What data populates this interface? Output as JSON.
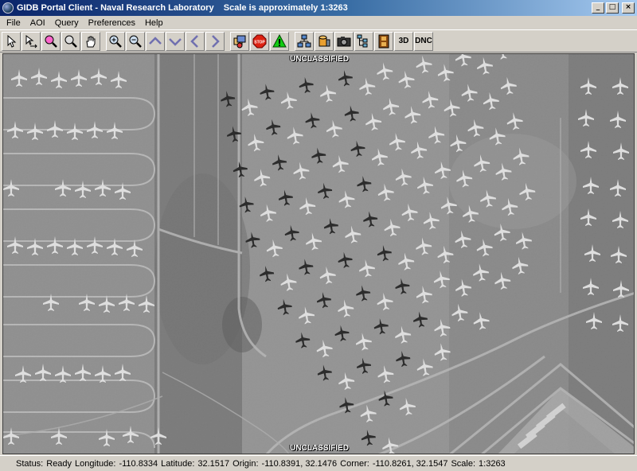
{
  "window": {
    "title": "GIDB Portal Client - Naval Research Laboratory    Scale is approximately 1:3263",
    "controls": [
      "minimize",
      "maximize",
      "close"
    ]
  },
  "menu": [
    "File",
    "AOI",
    "Query",
    "Preferences",
    "Help"
  ],
  "toolbar": {
    "buttons": [
      {
        "icon": "pointer-icon"
      },
      {
        "icon": "select-aoi-icon"
      },
      {
        "icon": "zoom-region-icon"
      },
      {
        "icon": "magnify-icon"
      },
      {
        "icon": "pan-hand-icon"
      },
      {
        "icon": "zoom-in-icon"
      },
      {
        "icon": "zoom-out-icon"
      },
      {
        "icon": "pan-up-icon"
      },
      {
        "icon": "pan-down-icon"
      },
      {
        "icon": "pan-left-icon"
      },
      {
        "icon": "pan-right-icon"
      },
      {
        "icon": "layers-icon"
      },
      {
        "icon": "stop-icon",
        "label": "STOP"
      },
      {
        "icon": "warning-icon"
      },
      {
        "icon": "network-icon"
      },
      {
        "icon": "database-icon"
      },
      {
        "icon": "camera-icon"
      },
      {
        "icon": "tree-icon"
      },
      {
        "icon": "film-icon"
      },
      {
        "icon": "3d-view-icon",
        "label": "3D"
      },
      {
        "icon": "dnc-icon",
        "label": "DNC"
      }
    ]
  },
  "map": {
    "classification_top": "UNCLASSIFIED",
    "classification_bottom": "UNCLASSIFIED"
  },
  "status": {
    "status_label": "Status:",
    "status_value": "Ready",
    "longitude_label": "Longitude:",
    "longitude_value": "-110.8334",
    "latitude_label": "Latitude:",
    "latitude_value": "32.1517",
    "origin_label": "Origin:",
    "origin_value": "-110.8391, 32.1476",
    "corner_label": "Corner:",
    "corner_value": "-110.8261, 32.1547",
    "scale_label": "Scale:",
    "scale_value": "1:3263"
  }
}
